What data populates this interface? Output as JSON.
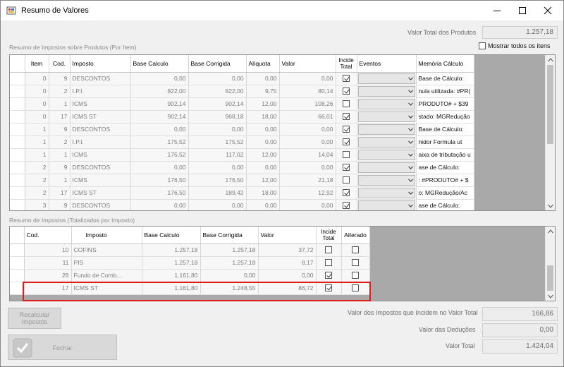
{
  "window": {
    "title": "Resumo de Valores"
  },
  "header": {
    "total_label": "Valor Total dos Produtos",
    "total_value": "1.257,18"
  },
  "products": {
    "group_title": "Resumo de Impostos sobre Produtos (Por Item)",
    "show_all_label": "Mostrar todos os itens",
    "show_all_checked": false,
    "columns": [
      "Item",
      "Cod.",
      "Imposto",
      "Base Calculo",
      "Base Corrigida",
      "Alíquota",
      "Valor",
      "Incide Total",
      "Eventos",
      "Memória Cálculo"
    ],
    "rows": [
      {
        "item": "0",
        "cod": "9",
        "imposto": "DESCONTOS",
        "base": "0,00",
        "corrigida": "0,00",
        "aliquota": "0,00",
        "valor": "0,00",
        "incide": true,
        "memoria": "Base de Cálculo:"
      },
      {
        "item": "0",
        "cod": "2",
        "imposto": "I.P.I.",
        "base": "822,00",
        "corrigida": "822,00",
        "aliquota": "9,75",
        "valor": "80,14",
        "incide": true,
        "memoria": "nula utilizada: #PR("
      },
      {
        "item": "0",
        "cod": "1",
        "imposto": "ICMS",
        "base": "902,14",
        "corrigida": "902,14",
        "aliquota": "12,00",
        "valor": "108,26",
        "incide": false,
        "memoria": "PRODUTO# + $39"
      },
      {
        "item": "0",
        "cod": "17",
        "imposto": "ICMS ST",
        "base": "902,14",
        "corrigida": "968,18",
        "aliquota": "18,00",
        "valor": "66,01",
        "incide": true,
        "memoria": "stado: MGRedução"
      },
      {
        "item": "1",
        "cod": "9",
        "imposto": "DESCONTOS",
        "base": "0,00",
        "corrigida": "0,00",
        "aliquota": "0,00",
        "valor": "0,00",
        "incide": true,
        "memoria": "Base de Cálculo:"
      },
      {
        "item": "1",
        "cod": "2",
        "imposto": "I.P.I.",
        "base": "175,52",
        "corrigida": "175,52",
        "aliquota": "0,00",
        "valor": "0,00",
        "incide": true,
        "memoria": "nidor    Formula ut"
      },
      {
        "item": "1",
        "cod": "1",
        "imposto": "ICMS",
        "base": "175,52",
        "corrigida": "117,02",
        "aliquota": "12,00",
        "valor": "14,04",
        "incide": false,
        "memoria": "aixa de tributação u"
      },
      {
        "item": "2",
        "cod": "9",
        "imposto": "DESCONTOS",
        "base": "0,00",
        "corrigida": "0,00",
        "aliquota": "0,00",
        "valor": "0,00",
        "incide": true,
        "memoria": "ase de Cálculo:"
      },
      {
        "item": "2",
        "cod": "1",
        "imposto": "ICMS",
        "base": "176,50",
        "corrigida": "176,50",
        "aliquota": "12,00",
        "valor": "21,18",
        "incide": false,
        "memoria": ": #PRODUTO# + $"
      },
      {
        "item": "2",
        "cod": "17",
        "imposto": "ICMS ST",
        "base": "176,50",
        "corrigida": "189,42",
        "aliquota": "18,00",
        "valor": "12,92",
        "incide": true,
        "memoria": "o: MGRedução/Ac"
      },
      {
        "item": "3",
        "cod": "9",
        "imposto": "DESCONTOS",
        "base": "0,00",
        "corrigida": "0,00",
        "aliquota": "0,00",
        "valor": "0,00",
        "incide": true,
        "memoria": "ase de Cálculo:"
      }
    ]
  },
  "totals": {
    "group_title": "Resumo de Impostos (Totalizados por Imposto)",
    "columns": [
      "Cod.",
      "Imposto",
      "Base Calculo",
      "Base Corrigida",
      "Valor",
      "Incide Total",
      "Alterado"
    ],
    "rows": [
      {
        "cod": "10",
        "imposto": "COFINS",
        "base": "1.257,18",
        "corrigida": "1.257,18",
        "valor": "37,72",
        "incide": false,
        "alterado": false
      },
      {
        "cod": "11",
        "imposto": "PIS",
        "base": "1.257,18",
        "corrigida": "1.257,18",
        "valor": "8,17",
        "incide": false,
        "alterado": false
      },
      {
        "cod": "28",
        "imposto": "Fundo de Comb...",
        "base": "1.161,80",
        "corrigida": "0,00",
        "valor": "0,00",
        "incide": true,
        "alterado": false
      },
      {
        "cod": "17",
        "imposto": "ICMS ST",
        "base": "1.161,80",
        "corrigida": "1.248,55",
        "valor": "86,72",
        "incide": true,
        "alterado": false
      }
    ]
  },
  "buttons": {
    "recalc": "Recalcular Impostos",
    "close": "Fechar"
  },
  "summary": {
    "impostos_label": "Valor dos Impostos que Incidem no Valor Total",
    "impostos_value": "166,86",
    "deducoes_label": "Valor das Deduções",
    "deducoes_value": "0,00",
    "total_label": "Valor Total",
    "total_value": "1.424,04"
  }
}
